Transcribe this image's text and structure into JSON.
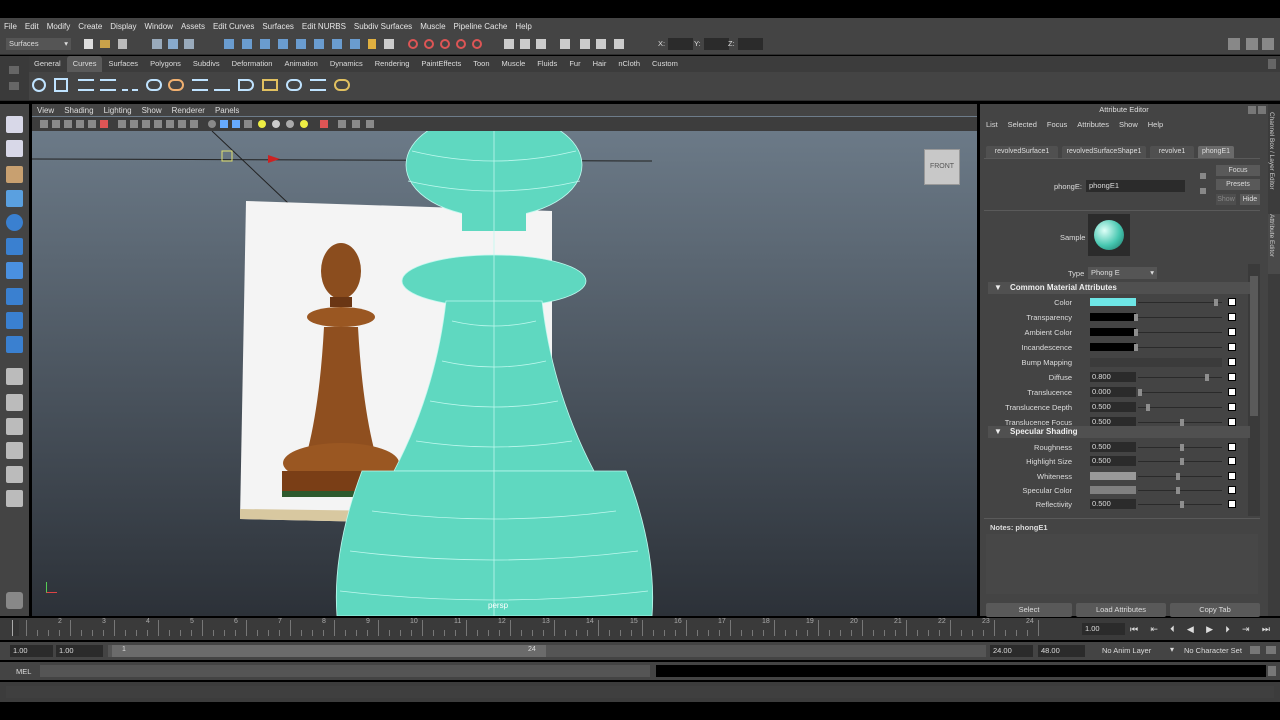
{
  "menubar": [
    "File",
    "Edit",
    "Modify",
    "Create",
    "Display",
    "Window",
    "Assets",
    "Edit Curves",
    "Surfaces",
    "Edit NURBS",
    "Subdiv Surfaces",
    "Muscle",
    "Pipeline Cache",
    "Help"
  ],
  "status": {
    "mode": "Surfaces",
    "x_label": "X:",
    "y_label": "Y:",
    "z_label": "Z:"
  },
  "shelf_tabs": [
    "General",
    "Curves",
    "Surfaces",
    "Polygons",
    "Subdivs",
    "Deformation",
    "Animation",
    "Dynamics",
    "Rendering",
    "PaintEffects",
    "Toon",
    "Muscle",
    "Fluids",
    "Fur",
    "Hair",
    "nCloth",
    "Custom"
  ],
  "active_shelf_tab": "Curves",
  "viewport": {
    "menu": [
      "View",
      "Shading",
      "Lighting",
      "Show",
      "Renderer",
      "Panels"
    ],
    "camera_label": "persp",
    "view_cube": "FRONT"
  },
  "attribute_editor": {
    "title": "Attribute Editor",
    "menu": [
      "List",
      "Selected",
      "Focus",
      "Attributes",
      "Show",
      "Help"
    ],
    "tabs": [
      "revolvedSurface1",
      "revolvedSurfaceShape1",
      "revolve1",
      "phongE1"
    ],
    "active_tab": "phongE1",
    "node_label": "phongE:",
    "node_name": "phongE1",
    "buttons": {
      "focus": "Focus",
      "presets": "Presets",
      "show": "Show",
      "hide": "Hide"
    },
    "sample_label": "Sample",
    "type_label": "Type",
    "type_value": "Phong E",
    "common_section": "Common Material Attributes",
    "common": [
      {
        "label": "Color",
        "swatch": "#6ee6e6",
        "slider": 0.95
      },
      {
        "label": "Transparency",
        "swatch": "#000000",
        "slider": 0.0
      },
      {
        "label": "Ambient Color",
        "swatch": "#000000",
        "slider": 0.0
      },
      {
        "label": "Incandescence",
        "swatch": "#000000",
        "slider": 0.0
      },
      {
        "label": "Bump Mapping"
      },
      {
        "label": "Diffuse",
        "value": "0.800",
        "slider": 0.8
      },
      {
        "label": "Translucence",
        "value": "0.000",
        "slider": 0.0
      },
      {
        "label": "Translucence Depth",
        "value": "0.500",
        "slider": 0.1
      },
      {
        "label": "Translucence Focus",
        "value": "0.500",
        "slider": 0.5
      }
    ],
    "specular_section": "Specular Shading",
    "specular": [
      {
        "label": "Roughness",
        "value": "0.500",
        "slider": 0.5
      },
      {
        "label": "Highlight Size",
        "value": "0.500",
        "slider": 0.5
      },
      {
        "label": "Whiteness",
        "swatch": "#9a9a9a",
        "slider": 0.5
      },
      {
        "label": "Specular Color",
        "swatch": "#808080",
        "slider": 0.5
      },
      {
        "label": "Reflectivity",
        "value": "0.500",
        "slider": 0.5
      }
    ],
    "notes_label": "Notes: phongE1",
    "bottom_buttons": [
      "Select",
      "Load Attributes",
      "Copy Tab"
    ]
  },
  "side_tabs": [
    "Channel Box / Layer Editor",
    "Attribute Editor"
  ],
  "time_slider": {
    "ticks": [
      "1",
      "2",
      "3",
      "4",
      "5",
      "6",
      "7",
      "8",
      "9",
      "10",
      "11",
      "12",
      "13",
      "14",
      "15",
      "16",
      "17",
      "18",
      "19",
      "20",
      "21",
      "22",
      "23",
      "24"
    ],
    "current": "1.00"
  },
  "range": {
    "start": "1.00",
    "inner_start": "1.00",
    "frame_marker": "1",
    "range_end_marker": "24",
    "end": "24.00",
    "outer_end": "48.00",
    "anim_layer": "No Anim Layer",
    "char_set": "No Character Set"
  },
  "mel_label": "MEL",
  "colors": {
    "accent": "#6ee6e6",
    "panel": "#444444",
    "viewport_top": "#6f7e8c"
  }
}
